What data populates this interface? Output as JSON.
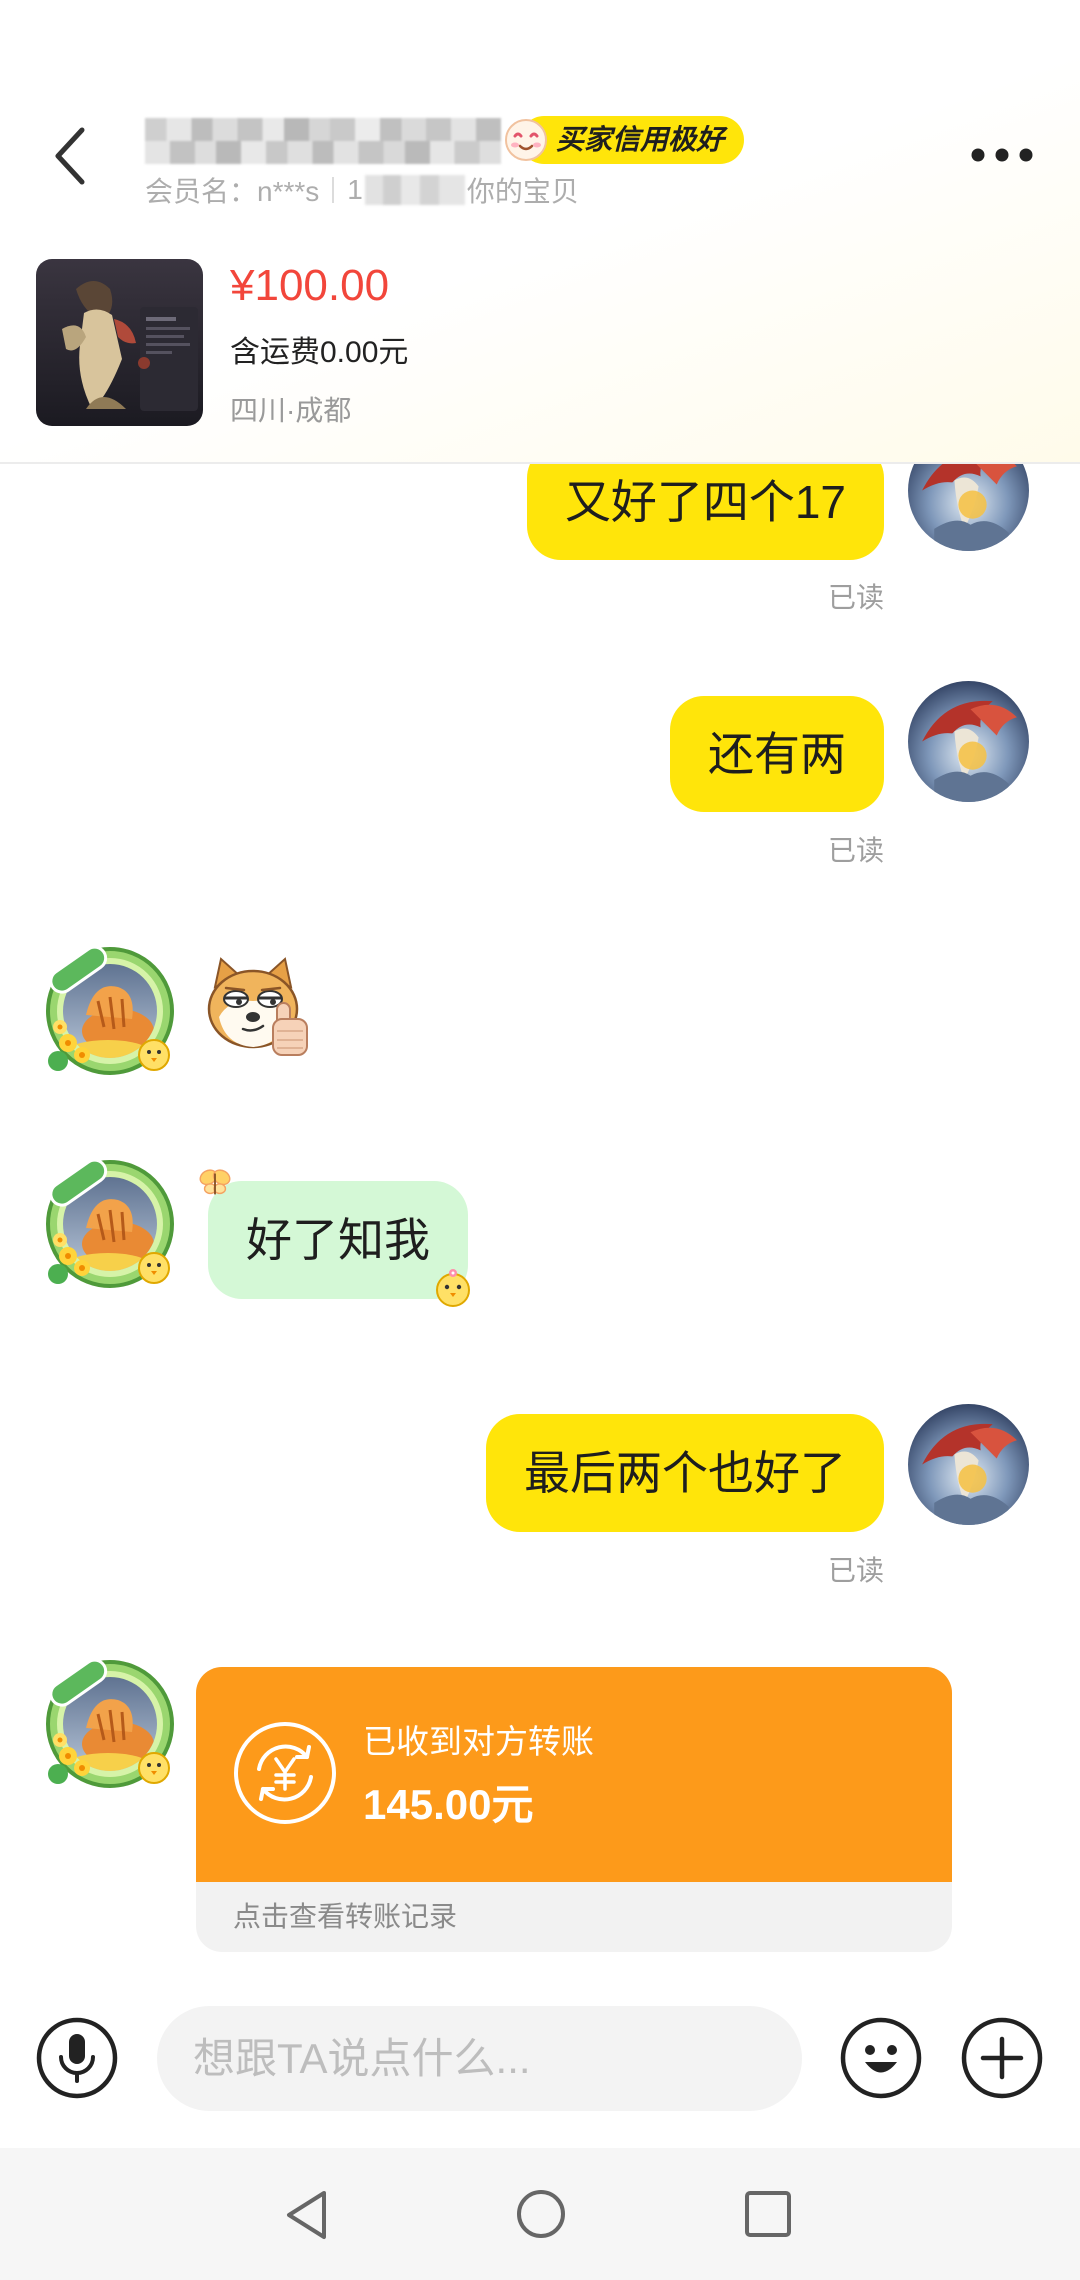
{
  "header": {
    "credit_badge": "买家信用极好",
    "member_label": "会员名：n***s",
    "subtitle_prefix": "1",
    "subtitle_suffix": "你的宝贝"
  },
  "product": {
    "price": "¥100.00",
    "shipping": "含运费0.00元",
    "location": "四川·成都"
  },
  "messages": [
    {
      "from_self": true,
      "text": "又好了四个17",
      "status": "已读"
    },
    {
      "from_self": true,
      "text": "还有两",
      "status": "已读"
    },
    {
      "from_self": false,
      "sticker": "doge-thumbs-up-sticker"
    },
    {
      "from_self": false,
      "text": "好了知我"
    },
    {
      "from_self": true,
      "text": "最后两个也好了",
      "status": "已读"
    },
    {
      "from_self": false,
      "transfer": {
        "title": "已收到对方转账",
        "amount": "145.00元",
        "link": "点击查看转账记录"
      }
    }
  ],
  "input": {
    "placeholder": "想跟TA说点什么..."
  },
  "icons": {
    "back": "chevron-left-icon",
    "more": "more-horizontal-icon",
    "badge": "smiley-face-icon",
    "transfer": "yuan-exchange-icon",
    "mic": "microphone-icon",
    "emoji": "emoji-smile-icon",
    "plus": "plus-circle-icon",
    "nav_back": "triangle-back-icon",
    "nav_home": "circle-home-icon",
    "nav_recent": "square-recent-icon"
  },
  "colors": {
    "bubble_self": "#FFE50A",
    "bubble_other": "#D4F8D6",
    "price": "#F2463B",
    "transfer_card": "#FD9A1A",
    "credit_badge": "#FFE50A"
  }
}
